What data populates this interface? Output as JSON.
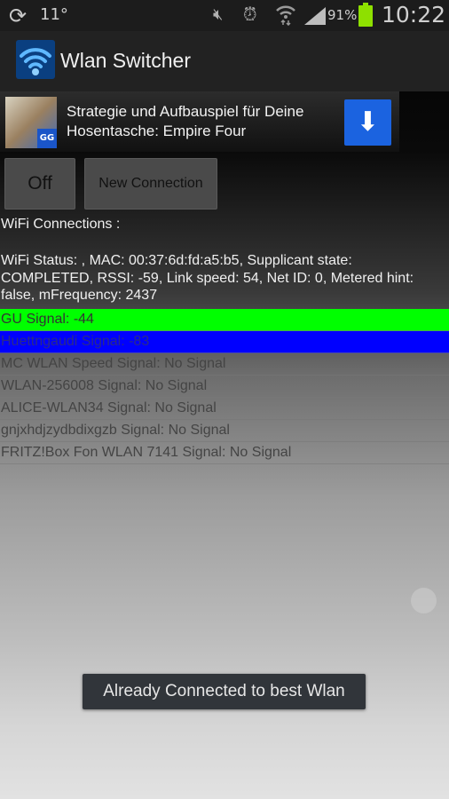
{
  "status_bar": {
    "sync_icon": "sync-icon",
    "temperature": "11°",
    "mute_icon": "mute-icon",
    "alarm_icon": "alarm-icon",
    "wifi_icon": "wifi-icon",
    "signal_icon": "cell-signal-icon",
    "battery_percent": "91%",
    "battery_icon": "battery-icon",
    "battery_color": "#8ee000",
    "time": "10:22"
  },
  "action_bar": {
    "app_icon": "wifi-app-icon",
    "title": "Wlan Switcher"
  },
  "ad_banner": {
    "text": "Strategie und Aufbauspiel für Deine Hosentasche: Empire Four",
    "badge": "GG",
    "download_icon": "download-arrow-icon",
    "download_glyph": "⬇",
    "button_color": "#1b63e0"
  },
  "buttons": {
    "off_label": "Off",
    "new_connection_label": "New Connection"
  },
  "connections_title": "WiFi Connections :",
  "wifi_status": "WiFi Status: , MAC: 00:37:6d:fd:a5:b5, Supplicant state: COMPLETED, RSSI: -59, Link speed: 54, Net ID: 0, Metered hint: false, mFrequency: 2437",
  "networks": [
    {
      "label": "GU Signal: -44",
      "bg": "#00ff00",
      "color": "#333333"
    },
    {
      "label": "Huettngaudi Signal: -83",
      "bg": "#0000ff",
      "color": "#2a2a8a"
    },
    {
      "label": "MC WLAN Speed Signal: No Signal",
      "bg": "",
      "color": "#444444"
    },
    {
      "label": "WLAN-256008 Signal: No Signal",
      "bg": "",
      "color": "#444444"
    },
    {
      "label": "ALICE-WLAN34 Signal: No Signal",
      "bg": "",
      "color": "#444444"
    },
    {
      "label": "gnjxhdjzydbdixgzb Signal: No Signal",
      "bg": "",
      "color": "#444444"
    },
    {
      "label": "FRITZ!Box Fon WLAN 7141 Signal: No Signal",
      "bg": "",
      "color": "#444444"
    }
  ],
  "toast": "Already Connected to best Wlan"
}
